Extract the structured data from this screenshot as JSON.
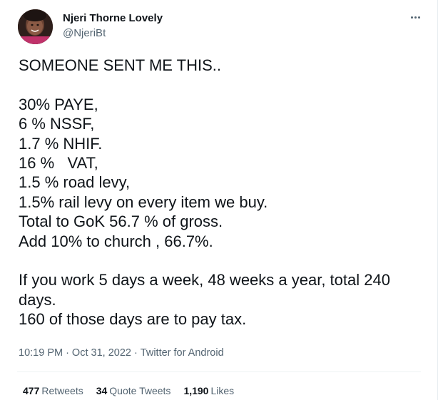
{
  "author": {
    "display_name": "Njeri Thorne Lovely",
    "handle": "@NjeriBt"
  },
  "icons": {
    "more": "more-horizontal-icon"
  },
  "tweet": {
    "text": "SOMEONE SENT ME THIS..\n\n30% PAYE,\n6 % NSSF,\n1.7 % NHIF.\n16 %   VAT,\n1.5 % road levy,\n1.5% rail levy on every item we buy.\nTotal to GoK 56.7 % of gross.\nAdd 10% to church , 66.7%.\n\nIf you work 5 days a week, 48 weeks a year, total 240 days.\n160 of those days are to pay tax.",
    "time": "10:19 PM",
    "separator": "·",
    "date": "Oct 31, 2022",
    "source": "Twitter for Android"
  },
  "stats": {
    "retweets_count": "477",
    "retweets_label": "Retweets",
    "quotes_count": "34",
    "quotes_label": "Quote Tweets",
    "likes_count": "1,190",
    "likes_label": "Likes"
  },
  "colors": {
    "text_primary": "#0f1419",
    "text_secondary": "#536471",
    "divider": "#eff3f4"
  }
}
